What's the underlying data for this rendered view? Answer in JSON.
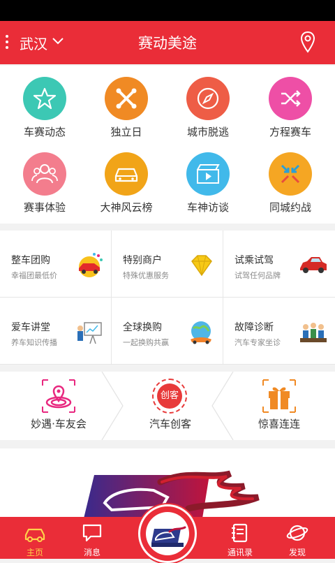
{
  "header": {
    "city": "武汉",
    "title": "赛动美途"
  },
  "grid": [
    {
      "label": "车赛动态",
      "icon": "star-icon",
      "color": "#3cc8b4"
    },
    {
      "label": "独立日",
      "icon": "bones-icon",
      "color": "#f08a24"
    },
    {
      "label": "城市脱逃",
      "icon": "compass-icon",
      "color": "#ee5d46"
    },
    {
      "label": "方程赛车",
      "icon": "shuffle-icon",
      "color": "#ee4fa6"
    },
    {
      "label": "赛事体验",
      "icon": "group-icon",
      "color": "#f37d8d"
    },
    {
      "label": "大神风云榜",
      "icon": "car-icon",
      "color": "#f1a418"
    },
    {
      "label": "车神访谈",
      "icon": "video-icon",
      "color": "#41b9ea"
    },
    {
      "label": "同城约战",
      "icon": "arrows-icon",
      "color": "#f5a623"
    }
  ],
  "services": [
    {
      "title": "整车团购",
      "sub": "幸福团最低价"
    },
    {
      "title": "特别商户",
      "sub": "特殊优惠服务"
    },
    {
      "title": "试乘试驾",
      "sub": "试驾任何品牌"
    },
    {
      "title": "爱车讲堂",
      "sub": "养车知识传播"
    },
    {
      "title": "全球换购",
      "sub": "一起换购共赢"
    },
    {
      "title": "故障诊断",
      "sub": "汽车专家坐诊"
    }
  ],
  "promos": [
    {
      "label": "妙遇·车友会",
      "color": "#e8287f"
    },
    {
      "label": "汽车创客",
      "color": "#e83a3a",
      "badge": "创客"
    },
    {
      "label": "惊喜连连",
      "color": "#f08a24"
    }
  ],
  "tabs": [
    {
      "label": "主页",
      "icon": "car-icon",
      "active": true
    },
    {
      "label": "消息",
      "icon": "chat-icon"
    },
    {
      "label": "通讯录",
      "icon": "contacts-icon"
    },
    {
      "label": "发现",
      "icon": "planet-icon"
    }
  ],
  "colors": {
    "brand": "#ea2d38",
    "active_tab": "#ffd24a"
  }
}
